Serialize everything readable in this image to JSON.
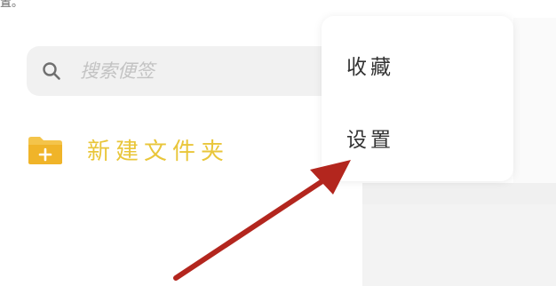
{
  "top_fragment": "置。",
  "search": {
    "placeholder": "搜索便签",
    "icon": "search-icon"
  },
  "new_folder": {
    "label": "新建文件夹",
    "icon": "folder-plus-icon",
    "color": "#E9C63A"
  },
  "menu": {
    "items": [
      {
        "label": "收藏"
      },
      {
        "label": "设置"
      }
    ]
  },
  "annotation": {
    "icon": "arrow-icon",
    "color": "#B3261E"
  }
}
